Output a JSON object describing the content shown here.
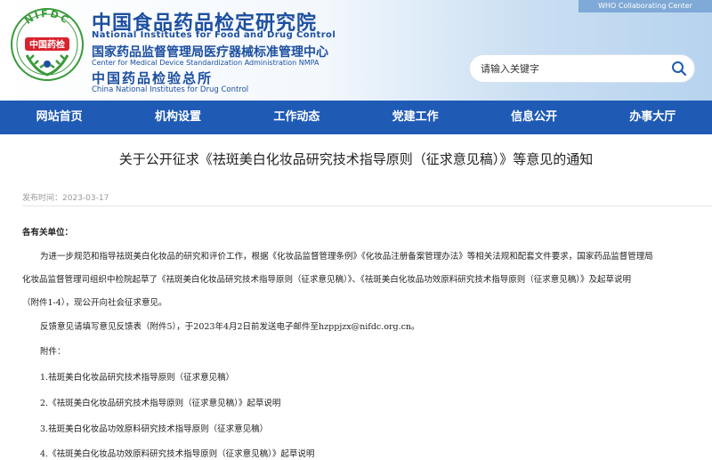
{
  "header": {
    "logo_text": "NIFDC",
    "logo_cn": "中国药检",
    "title_cn": "中国食品药品检定研究院",
    "title_en": "National Institutes for Food and Drug Control",
    "center_cn": "国家药品监督管理局医疗器械标准管理中心",
    "center_en": "Center for Medical Device Standardization Administration NMPA",
    "inst_cn": "中国药品检验总所",
    "inst_en": "China National Institutes for Drug Control",
    "who_badge": "WHO Collaborating Center",
    "search_placeholder": "请输入关键字"
  },
  "nav": {
    "items": [
      "网站首页",
      "机构设置",
      "工作动态",
      "党建工作",
      "信息公开",
      "办事大厅"
    ]
  },
  "article": {
    "title": "关于公开征求《祛斑美白化妆品研究技术指导原则（征求意见稿）》等意见的通知",
    "date_label": "发布时间：",
    "date": "2023-03-17",
    "salutation": "各有关单位：",
    "para1_line1": "为进一步规范和指导祛斑美白化妆品的研究和评价工作，根据《化妆品监督管理条例》《化妆品注册备案管理办法》等相关法规和配套文件要求，国家药品监督管理局",
    "para1_line2": "化妆品监督管理司组织中检院起草了《祛斑美白化妆品研究技术指导原则（征求意见稿）》、《祛斑美白化妆品功效原料研究技术指导原则（征求意见稿）》及起草说明",
    "para1_line3": "（附件1-4），现公开向社会征求意见。",
    "para2": "反馈意见请填写意见反馈表（附件5），于2023年4月2日前发送电子邮件至hzppjzx@nifdc.org.cn。",
    "attachments_label": "附件：",
    "attachments": [
      "1.祛斑美白化妆品研究技术指导原则（征求意见稿）",
      "2.《祛斑美白化妆品研究技术指导原则（征求意见稿）》起草说明",
      "3.祛斑美白化妆品功效原料研究技术指导原则（征求意见稿）",
      "4.《祛斑美白化妆品功效原料研究技术指导原则（征求意见稿）》起草说明"
    ]
  },
  "colors": {
    "brand_blue": "#1d4fa0",
    "nav_blue": "#1f5bb5",
    "logo_green": "#3a9a3a",
    "logo_red": "#d9232e"
  }
}
